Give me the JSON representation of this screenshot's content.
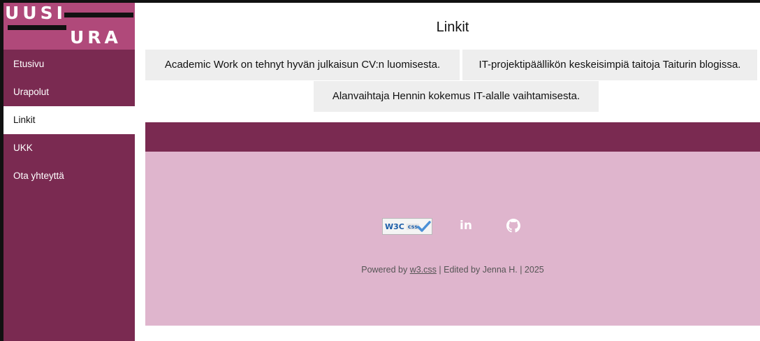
{
  "logo": {
    "line1": "UUSI",
    "line2": "URA"
  },
  "nav": {
    "items": [
      {
        "label": "Etusivu",
        "active": false
      },
      {
        "label": "Urapolut",
        "active": false
      },
      {
        "label": "Linkit",
        "active": true
      },
      {
        "label": "UKK",
        "active": false
      },
      {
        "label": "Ota yhteyttä",
        "active": false
      }
    ]
  },
  "main": {
    "title": "Linkit",
    "links": [
      "Academic Work on tehnyt hyvän julkaisun CV:n luomisesta.",
      "IT-projektipäällikön keskeisimpiä taitoja Taiturin blogissa.",
      "Alanvaihtaja Hennin kokemus IT-alalle vaihtamisesta."
    ]
  },
  "footer": {
    "badge": {
      "w3c": "W3C",
      "css": "css"
    },
    "linkedin": "in",
    "powered_prefix": "Powered by ",
    "powered_link": "w3.css",
    "powered_suffix": " | Edited by Jenna H. | 2025",
    "icons": [
      "w3c-css-badge-icon",
      "linkedin-icon",
      "github-icon"
    ]
  },
  "colors": {
    "sidebar": "#7a2a51",
    "logo_bg": "#b0497a",
    "footer_bg": "#dfb5cd",
    "button_bg": "#eeeeee"
  }
}
